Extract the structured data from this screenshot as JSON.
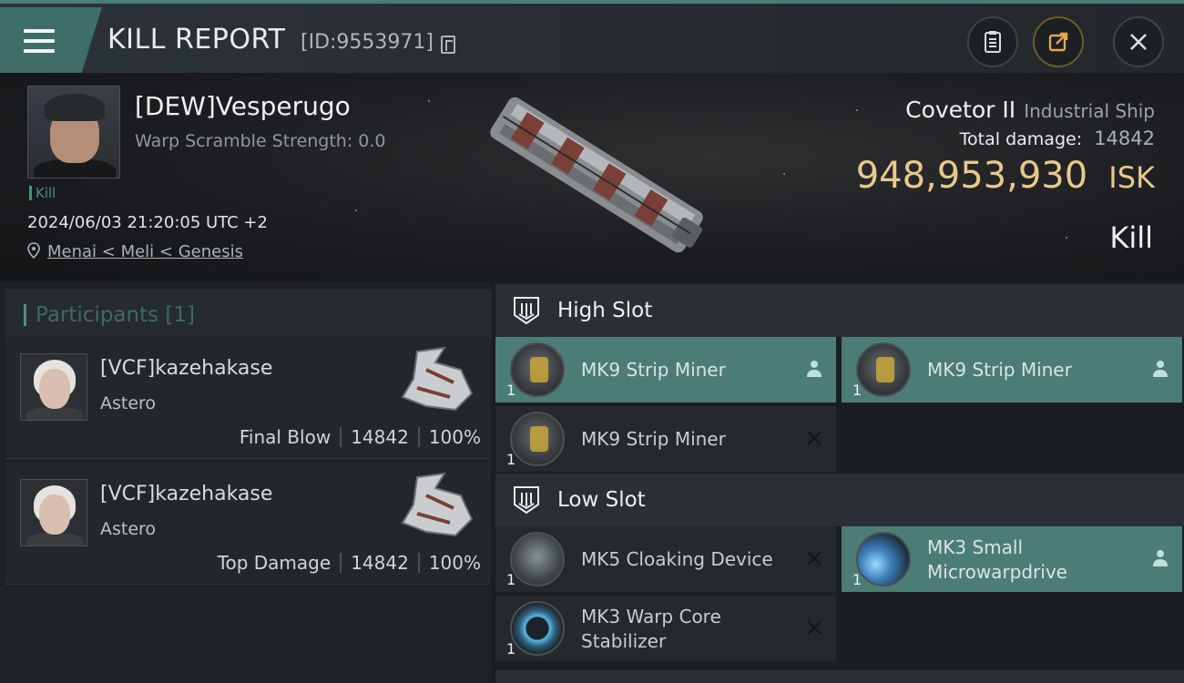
{
  "header": {
    "title": "KILL REPORT",
    "report_id": "[ID:9553971]"
  },
  "victim": {
    "name": "[DEW]Vesperugo",
    "warp_scramble": "Warp Scramble Strength: 0.0",
    "tag": "Kill",
    "timestamp": "2024/06/03 21:20:05 UTC +2",
    "location": "Menai < Meli < Genesis",
    "ship_name": "Covetor II",
    "ship_class": "Industrial Ship",
    "total_damage_label": "Total damage:",
    "total_damage": "14842",
    "isk_value": "948,953,930",
    "isk_unit": "ISK",
    "result": "Kill"
  },
  "participants": {
    "title": "Participants [1]",
    "items": [
      {
        "name": "[VCF]kazehakase",
        "ship": "Astero",
        "role": "Final Blow",
        "damage": "14842",
        "percent": "100%"
      },
      {
        "name": "[VCF]kazehakase",
        "ship": "Astero",
        "role": "Top Damage",
        "damage": "14842",
        "percent": "100%"
      }
    ]
  },
  "fitting": {
    "high_slot": {
      "title": "High Slot",
      "modules": [
        {
          "name": "MK9 Strip Miner",
          "qty": "1",
          "status": "dropped",
          "icon": "strip-miner-icon"
        },
        {
          "name": "MK9 Strip Miner",
          "qty": "1",
          "status": "dropped",
          "icon": "strip-miner-icon"
        },
        {
          "name": "MK9 Strip Miner",
          "qty": "1",
          "status": "destroyed",
          "icon": "strip-miner-icon"
        }
      ]
    },
    "low_slot": {
      "title": "Low Slot",
      "modules": [
        {
          "name": "MK5 Cloaking Device",
          "qty": "1",
          "status": "destroyed",
          "icon": "cloaking-device-icon"
        },
        {
          "name_line1": "MK3 Small",
          "name_line2": "Microwarpdrive",
          "qty": "1",
          "status": "dropped",
          "icon": "microwarpdrive-icon"
        },
        {
          "name_line1": "MK3 Warp Core",
          "name_line2": "Stabilizer",
          "qty": "1",
          "status": "destroyed",
          "icon": "warp-core-stabilizer-icon"
        }
      ]
    }
  },
  "colors": {
    "accent": "#4c7d74",
    "isk_gold": "#e7c98a",
    "panel": "#25292c"
  }
}
